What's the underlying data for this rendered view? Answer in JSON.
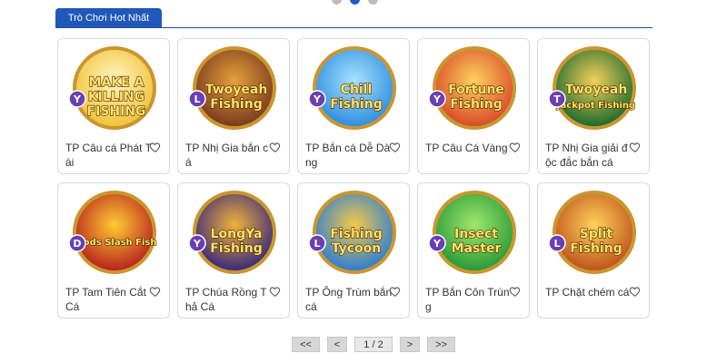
{
  "carousel_dots": {
    "count": 3,
    "active": 2
  },
  "section": {
    "tab_label": "Trò Chơi Hot Nhất"
  },
  "games": [
    {
      "name": "TP Câu cá Phát Tài",
      "badge": "Y",
      "logo_lines": [
        "MAKE A",
        "KILLING",
        "FISHING"
      ],
      "theme": "#f2c23b",
      "accent": "#fff6c2"
    },
    {
      "name": "TP Nhị Gia bắn cá",
      "badge": "L",
      "logo_lines": [
        "Twoyeah",
        "Fishing"
      ],
      "theme": "#7a3b1e",
      "accent": "#e6a03b"
    },
    {
      "name": "TP Bắn cá Dễ Dàng",
      "badge": "Y",
      "logo_lines": [
        "Chill",
        "Fishing"
      ],
      "theme": "#2f8fe0",
      "accent": "#a7e2ff"
    },
    {
      "name": "TP Câu Cá Vàng",
      "badge": "Y",
      "logo_lines": [
        "Fortune",
        "Fishing"
      ],
      "theme": "#d94b2b",
      "accent": "#ffd15c"
    },
    {
      "name": "TP Nhị Gia giải độc đắc bắn cá",
      "badge": "T",
      "logo_lines": [
        "Twoyeah",
        "Jackpot Fishing"
      ],
      "theme": "#1e6b2f",
      "accent": "#f3d05a"
    },
    {
      "name": "TP Tam Tiên Cắt Cá",
      "badge": "D",
      "logo_lines": [
        "Gods Slash Fish"
      ],
      "theme": "#b8231e",
      "accent": "#ffcc33"
    },
    {
      "name": "TP Chúa Rồng Thả Cá",
      "badge": "Y",
      "logo_lines": [
        "LongYa",
        "Fishing"
      ],
      "theme": "#3b2a7a",
      "accent": "#f0b23b"
    },
    {
      "name": "TP Ông Trùm bắn cá",
      "badge": "L",
      "logo_lines": [
        "Fishing",
        "Tycoon"
      ],
      "theme": "#2e7fd0",
      "accent": "#f5c84a"
    },
    {
      "name": "TP Bắn Côn Trùng",
      "badge": "Y",
      "logo_lines": [
        "Insect",
        "Master"
      ],
      "theme": "#2b9a3a",
      "accent": "#9ee86b"
    },
    {
      "name": "TP Chặt chém cá",
      "badge": "L",
      "logo_lines": [
        "Split",
        "Fishing"
      ],
      "theme": "#c0541c",
      "accent": "#ffd25a"
    }
  ],
  "pagination": {
    "first": "<<",
    "prev": "<",
    "status": "1 / 2",
    "next": ">",
    "last": ">>"
  },
  "colors": {
    "primary": "#1f58b8",
    "badge": "#6a3fb5"
  }
}
